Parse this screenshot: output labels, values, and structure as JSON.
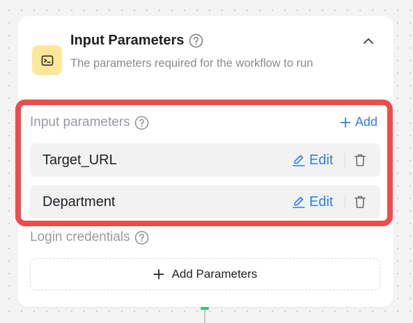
{
  "header": {
    "title": "Input Parameters",
    "subtitle": "The parameters required for the workflow to run",
    "icon": "terminal-icon",
    "icon_bg_color": "#fde79a"
  },
  "input_params": {
    "label": "Input parameters",
    "add_label": "Add",
    "edit_label": "Edit",
    "items": [
      {
        "name": "Target_URL"
      },
      {
        "name": "Department"
      }
    ]
  },
  "login_credentials": {
    "label": "Login credentials",
    "add_button_label": "Add Parameters"
  },
  "colors": {
    "accent": "#2f7ee8",
    "highlight": "#f04b4b",
    "connector": "#37c07a"
  }
}
